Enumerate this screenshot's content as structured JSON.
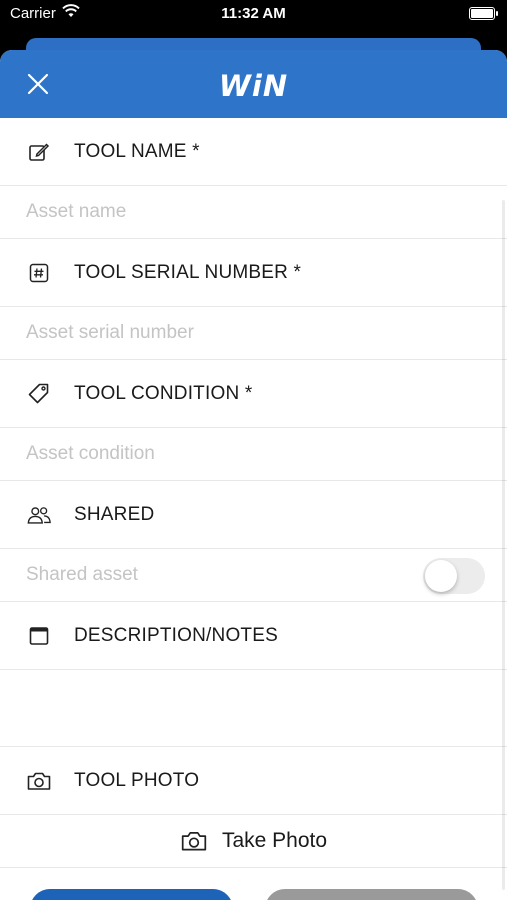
{
  "status_bar": {
    "carrier": "Carrier",
    "time": "11:32 AM"
  },
  "header": {
    "logo": "WiN",
    "close_icon": "close-icon"
  },
  "sections": {
    "tool_name": {
      "title": "TOOL NAME *",
      "placeholder": "Asset name",
      "icon": "edit-icon"
    },
    "serial": {
      "title": "TOOL SERIAL NUMBER *",
      "placeholder": "Asset serial number",
      "icon": "hash-icon"
    },
    "condition": {
      "title": "TOOL CONDITION *",
      "placeholder": "Asset condition",
      "icon": "tag-icon"
    },
    "shared": {
      "title": "SHARED",
      "label": "Shared asset",
      "toggle_on": false,
      "icon": "users-icon"
    },
    "description": {
      "title": "DESCRIPTION/NOTES",
      "icon": "window-icon"
    },
    "photo": {
      "title": "TOOL PHOTO",
      "take_photo": "Take Photo",
      "icon": "camera-icon"
    }
  },
  "colors": {
    "header": "#2e74c8",
    "primary_button": "#1d63b8",
    "secondary_button": "#9a9a9a"
  }
}
